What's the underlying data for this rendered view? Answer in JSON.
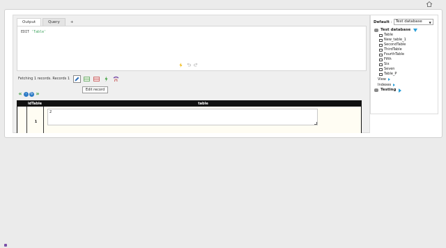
{
  "tabs": [
    "Output",
    "Query",
    "+"
  ],
  "editor": {
    "keyword": "EDIT",
    "table_string": "'Table'"
  },
  "results": {
    "status": "Fetching 1 records. Records 1",
    "tooltip": "Edit record",
    "columns": [
      "idTable",
      "table"
    ],
    "rows": [
      {
        "idTable": "1",
        "table": "2"
      }
    ]
  },
  "side": {
    "default_label": "Default",
    "selected_db": "Test database",
    "databases": [
      {
        "name": "Test database",
        "tables": [
          "Table",
          "New_table_1",
          "SecondTable",
          "ThirdTable",
          "FourthTable",
          "Fifth",
          "Six",
          "Seven",
          "Table_P"
        ],
        "groups": [
          "View",
          "Indexes"
        ]
      },
      {
        "name": "Testing"
      }
    ]
  },
  "colors": {
    "accent": "#2a9fd8",
    "nav_green": "#3c9a3c",
    "grid_header": "#111111",
    "grid_bg": "#fffdf3"
  },
  "icons": [
    "home-icon",
    "run-icon",
    "undo-icon",
    "redo-icon",
    "edit-record-icon",
    "add-record-icon",
    "delete-record-icon",
    "commit-icon",
    "rollback-icon",
    "first-page-icon",
    "previous-page-icon",
    "refresh-icon",
    "next-page-icon",
    "last-page-icon",
    "database-icon",
    "table-icon"
  ]
}
